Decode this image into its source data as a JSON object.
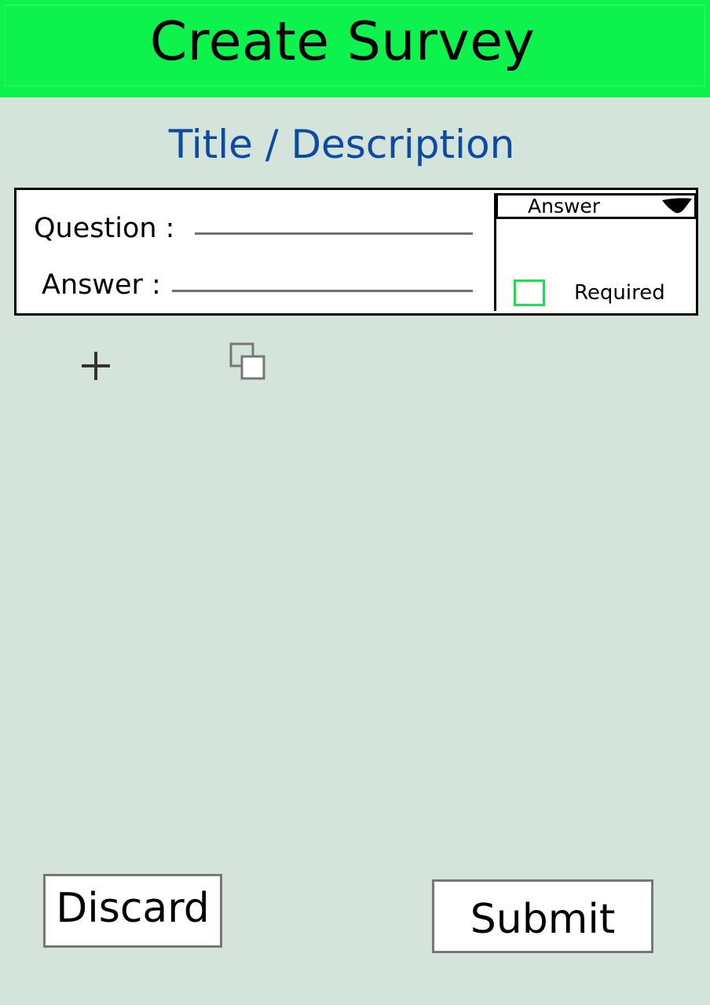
{
  "header": {
    "title": "Create Survey",
    "color": "#0df24d"
  },
  "survey": {
    "title_placeholder": "Title / Description"
  },
  "question_card": {
    "question_label": "Question :",
    "answer_label": "Answer :",
    "answer_type_dropdown": {
      "selected": "Answer",
      "icon": "caret-down-icon"
    },
    "required_checkbox": {
      "label": "Required",
      "checked": false,
      "color": "#19e34b"
    }
  },
  "actions": {
    "add_question_icon": "plus-icon",
    "duplicate_question_icon": "copy-icon"
  },
  "footer": {
    "discard_label": "Discard",
    "submit_label": "Submit"
  }
}
